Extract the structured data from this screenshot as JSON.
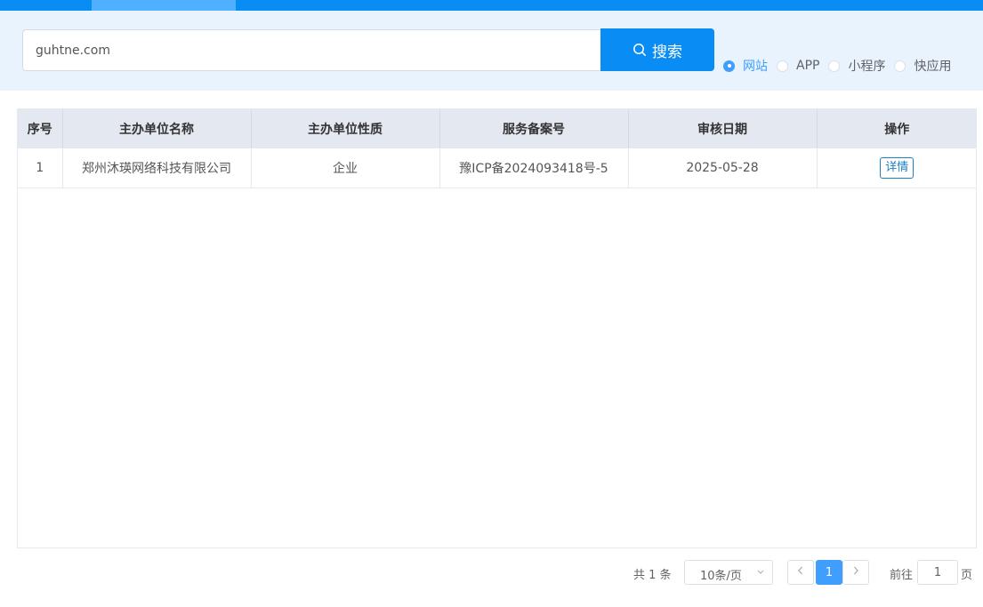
{
  "search": {
    "value": "guhtne.com",
    "button_label": "搜索"
  },
  "radios": [
    {
      "label": "网站",
      "checked": true
    },
    {
      "label": "APP",
      "checked": false
    },
    {
      "label": "小程序",
      "checked": false
    },
    {
      "label": "快应用",
      "checked": false
    }
  ],
  "table": {
    "headers": [
      "序号",
      "主办单位名称",
      "主办单位性质",
      "服务备案号",
      "审核日期",
      "操作"
    ],
    "rows": [
      {
        "index": "1",
        "org_name": "郑州沐瑛网络科技有限公司",
        "org_type": "企业",
        "record_no": "豫ICP备2024093418号-5",
        "date": "2025-05-28",
        "action_label": "详情"
      }
    ]
  },
  "pagination": {
    "total_text": "共 1 条",
    "page_size": "10条/页",
    "current_page": "1",
    "goto_label": "前往",
    "goto_value": "1",
    "page_suffix": "页"
  },
  "colors": {
    "primary": "#0a8cf5",
    "accent": "#409eff",
    "header_bg": "#e3e8f1",
    "search_bg": "#e8f3fd"
  },
  "icons": {
    "search": "search-icon",
    "prev": "chevron-left-icon",
    "next": "chevron-right-icon",
    "dropdown": "chevron-down-icon"
  }
}
